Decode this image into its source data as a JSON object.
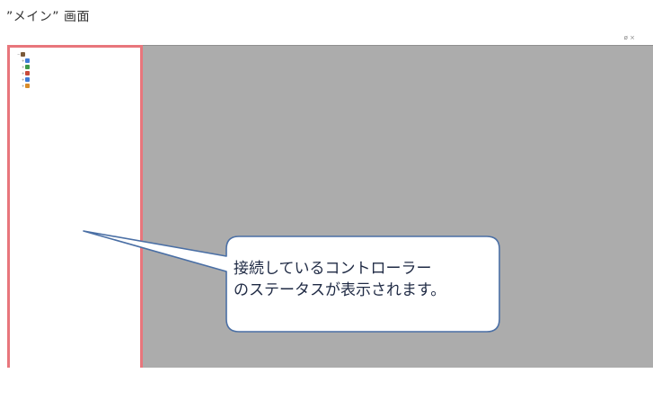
{
  "caption": "”メイン” 画面",
  "window": {
    "title": "",
    "controls": "ø ×"
  },
  "menubar": {
    "items": [
      "",
      "",
      "",
      "",
      "",
      "",
      "",
      "",
      "",
      "",
      ""
    ]
  },
  "toolbar": {
    "icons": [
      "folder-open-icon",
      "save-icon",
      "controller-icon",
      "pen-icon",
      "group-icon",
      "wrench-icon",
      "download-icon",
      "upload-icon",
      "grid-icon",
      "table-icon",
      "chart-icon",
      "stop-icon"
    ],
    "selects": [
      "",
      "",
      ""
    ]
  },
  "subbar": {
    "text": ""
  },
  "tree": {
    "items": [
      {
        "label": "",
        "level": 0,
        "color": "#7a5a3a"
      },
      {
        "label": "",
        "level": 1,
        "color": "#3e7bd6"
      },
      {
        "label": "",
        "level": 1,
        "color": "#3e9a4a"
      },
      {
        "label": "",
        "level": 1,
        "color": "#c84a3a"
      },
      {
        "label": "",
        "level": 1,
        "color": "#3e7bd6"
      },
      {
        "label": "",
        "level": 1,
        "color": "#d98c2a"
      }
    ]
  },
  "callout": {
    "line1": "接続しているコントローラー",
    "line2": "のステータスが表示されます。"
  },
  "colors": {
    "workspace": "#acacac",
    "highlight": "#e8767c",
    "callout_border": "#4a6fa5"
  }
}
